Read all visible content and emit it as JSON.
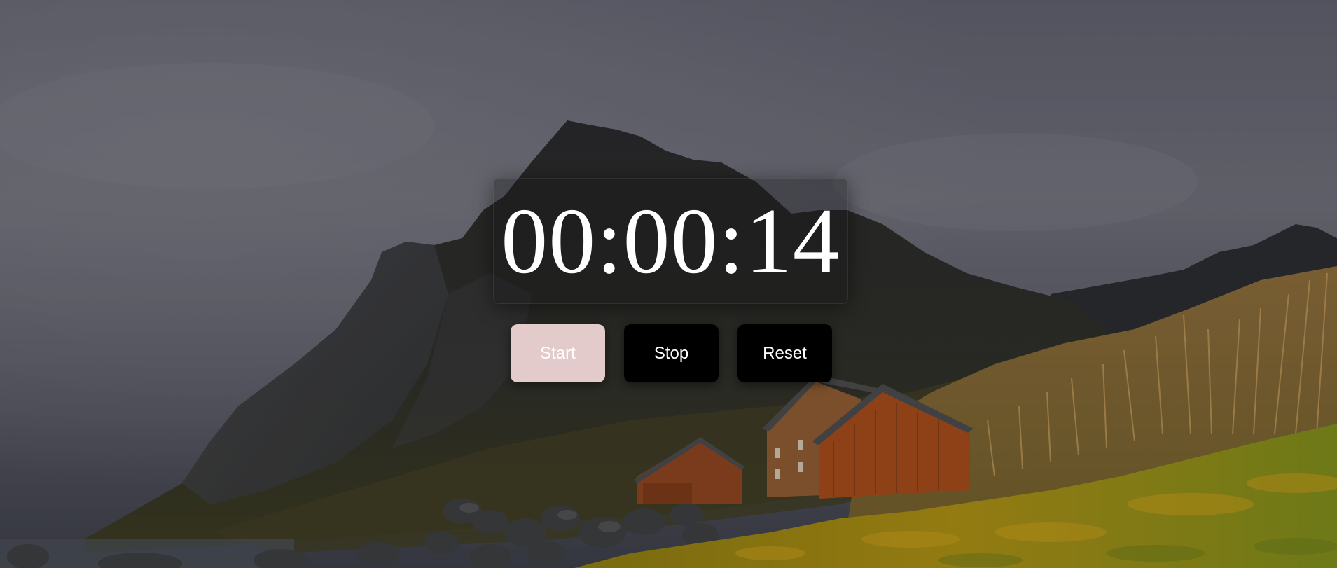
{
  "timer": {
    "display": "00:00:14"
  },
  "buttons": {
    "start_label": "Start",
    "stop_label": "Stop",
    "reset_label": "Reset"
  },
  "colors": {
    "start_button_bg": "#e3cbcb",
    "stop_button_bg": "#000000",
    "reset_button_bg": "#000000",
    "button_text": "#ffffff",
    "timer_text": "#ffffff"
  }
}
